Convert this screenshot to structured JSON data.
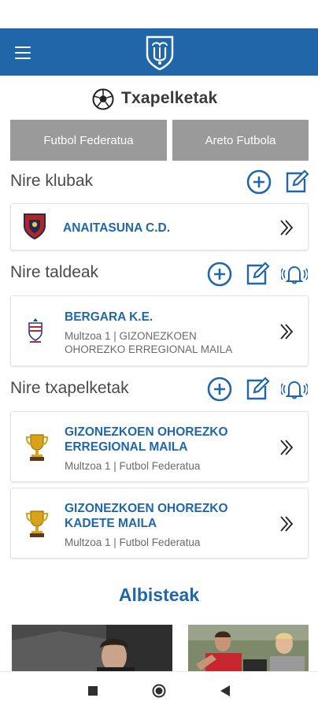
{
  "header": {
    "menu_icon": "hamburger-menu-icon",
    "logo_icon": "club-shield-logo-icon",
    "brand_color": "#1f67a8"
  },
  "page": {
    "title": "Txapelketak",
    "title_icon": "soccer-ball-icon"
  },
  "tabs": [
    {
      "label": "Futbol Federatua"
    },
    {
      "label": "Areto Futbola"
    }
  ],
  "sections": {
    "clubs": {
      "title": "Nire klubak",
      "actions": [
        "add-circle-icon",
        "edit-icon"
      ],
      "items": [
        {
          "name": "ANAITASUNA C.D.",
          "icon": "club-crest-icon"
        }
      ]
    },
    "teams": {
      "title": "Nire taldeak",
      "actions": [
        "add-circle-icon",
        "edit-icon",
        "notification-bell-icon"
      ],
      "items": [
        {
          "name": "BERGARA K.E.",
          "sub1": "Multzoa 1 | GIZONEZKOEN",
          "sub2": "OHOREZKO ERREGIONAL MAILA",
          "icon": "team-crest-icon"
        }
      ]
    },
    "competitions": {
      "title": "Nire txapelketak",
      "actions": [
        "add-circle-icon",
        "edit-icon",
        "notification-bell-icon"
      ],
      "items": [
        {
          "line1": "GIZONEZKOEN OHOREZKO",
          "line2": "ERREGIONAL MAILA",
          "sub": "Multzoa 1 | Futbol Federatua",
          "icon": "trophy-icon"
        },
        {
          "line1": "GIZONEZKOEN OHOREZKO",
          "line2": "KADETE MAILA",
          "sub": "Multzoa 1 | Futbol Federatua",
          "icon": "trophy-icon"
        }
      ]
    }
  },
  "news": {
    "title": "Albisteak"
  },
  "navbar": {
    "icons": [
      "recents-square-icon",
      "home-circle-icon",
      "back-triangle-icon"
    ]
  }
}
